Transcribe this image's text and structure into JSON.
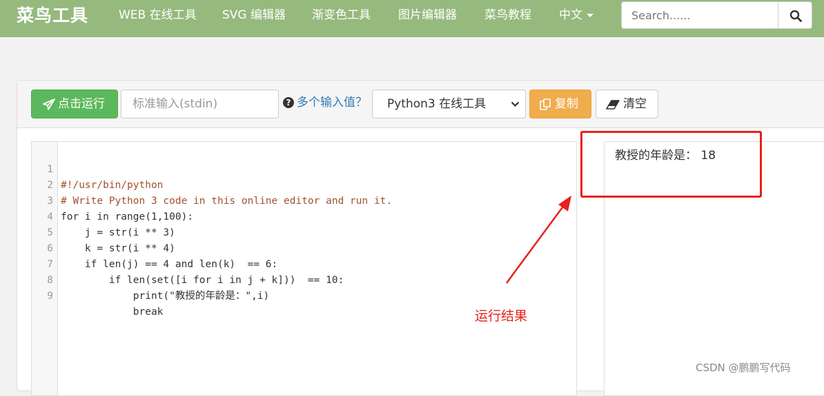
{
  "navbar": {
    "brand": "菜鸟工具",
    "links": [
      {
        "label": "WEB 在线工具"
      },
      {
        "label": "SVG 编辑器"
      },
      {
        "label": "渐变色工具"
      },
      {
        "label": "图片编辑器"
      },
      {
        "label": "菜鸟教程"
      },
      {
        "label": "中文"
      }
    ],
    "search_placeholder": "Search......",
    "search_icon": "magnifier-icon"
  },
  "toolbar": {
    "run_label": "点击运行",
    "run_icon": "paper-plane-icon",
    "stdin_placeholder": "标准输入(stdin)",
    "help_label": "多个输入值？",
    "language_selected": "Python3 在线工具",
    "copy_label": "复制",
    "copy_icon": "copy-icon",
    "clear_label": "清空",
    "clear_icon": "eraser-icon"
  },
  "editor": {
    "line_numbers": [
      "1",
      "2",
      "3",
      "4",
      "5",
      "6",
      "7",
      "8",
      "9"
    ],
    "lines": [
      "#!/usr/bin/python",
      "# Write Python 3 code in this online editor and run it.",
      "for i in range(1,100):",
      "    j = str(i ** 3)",
      "    k = str(i ** 4)",
      "    if len(j) == 4 and len(k)  == 6:",
      "        if len(set([i for i in j + k]))  == 10:",
      "            print(\"教授的年龄是：\",i)",
      "            break"
    ]
  },
  "output": {
    "text": "教授的年龄是： 18"
  },
  "annotation": {
    "label": "运行结果",
    "color": "#e8201a"
  },
  "watermark": "CSDN @鹏鹏写代码",
  "colors": {
    "navbar": "#96b97d",
    "run_button": "#5cb85c",
    "copy_button": "#f0ad4e",
    "link": "#337ab7"
  }
}
